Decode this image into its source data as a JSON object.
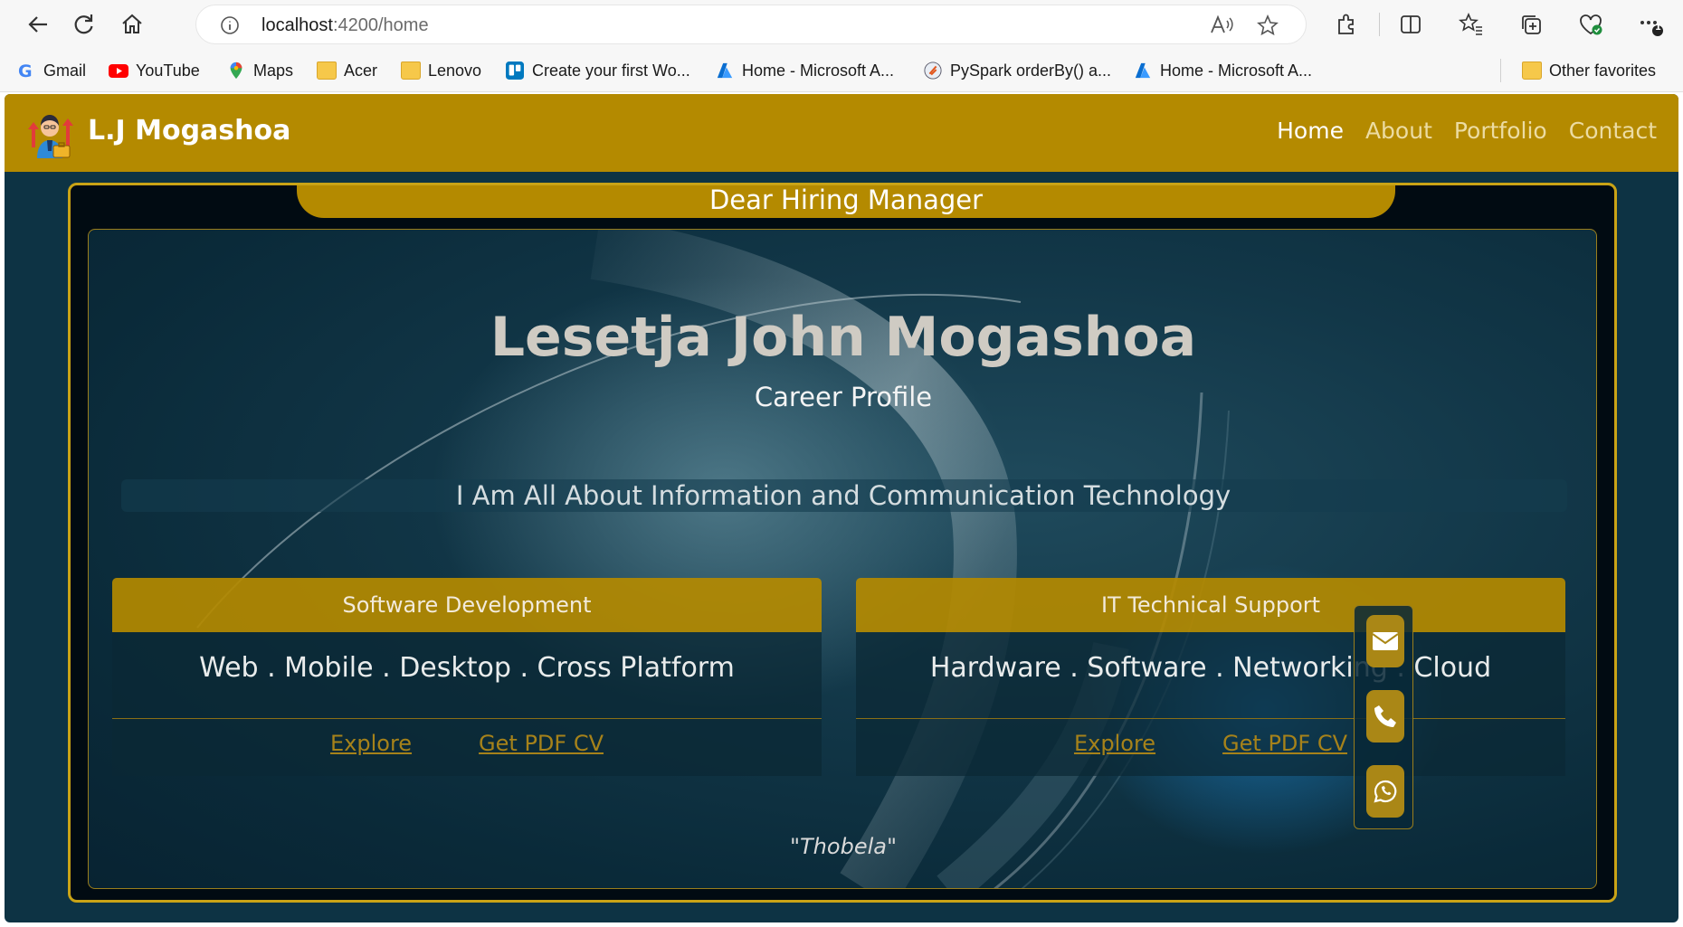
{
  "browser": {
    "url_host": "localhost",
    "url_path": ":4200/home",
    "bookmarks": [
      {
        "label": "Gmail",
        "icon": "gmail-icon"
      },
      {
        "label": "YouTube",
        "icon": "youtube-icon"
      },
      {
        "label": "Maps",
        "icon": "maps-icon"
      },
      {
        "label": "Acer",
        "icon": "folder-icon"
      },
      {
        "label": "Lenovo",
        "icon": "folder-icon"
      },
      {
        "label": "Create your first Wo...",
        "icon": "trello-icon"
      },
      {
        "label": "Home - Microsoft A...",
        "icon": "azure-icon"
      },
      {
        "label": "PySpark orderBy() a...",
        "icon": "sparkbyexamples-icon"
      },
      {
        "label": "Home - Microsoft A...",
        "icon": "azure-icon"
      }
    ],
    "other_favorites": "Other favorites",
    "notification_badge": "1"
  },
  "site": {
    "brand": "L.J Mogashoa",
    "nav": [
      {
        "label": "Home",
        "active": true
      },
      {
        "label": "About",
        "active": false
      },
      {
        "label": "Portfolio",
        "active": false
      },
      {
        "label": "Contact",
        "active": false
      }
    ],
    "accent_color": "#b48a00",
    "background_color": "#0d3344"
  },
  "hero": {
    "ribbon": "Dear Hiring Manager",
    "name": "Lesetja John Mogashoa",
    "subtitle": "Career Profile",
    "tagline": "I Am All About Information and Communication Technology",
    "quote": "\"Thobela\""
  },
  "cards": [
    {
      "title": "Software Development",
      "text": "Web . Mobile . Desktop . Cross Platform",
      "links": [
        "Explore",
        "Get PDF CV"
      ]
    },
    {
      "title": "IT Technical Support",
      "text": "Hardware . Software . Networking . Cloud",
      "links": [
        "Explore",
        "Get PDF CV"
      ]
    }
  ],
  "contact_buttons": [
    {
      "name": "email",
      "icon": "envelope-icon"
    },
    {
      "name": "phone",
      "icon": "phone-icon"
    },
    {
      "name": "whatsapp",
      "icon": "whatsapp-icon"
    }
  ]
}
